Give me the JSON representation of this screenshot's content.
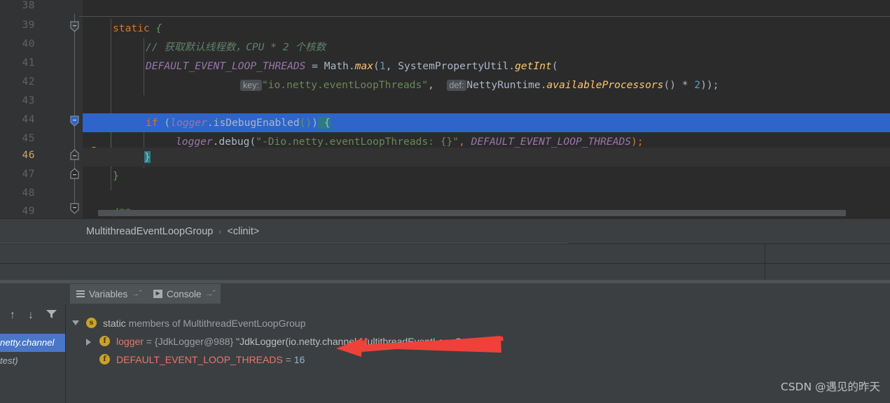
{
  "editor": {
    "lines": [
      {
        "no": "38",
        "state": "normal"
      },
      {
        "no": "39",
        "state": "normal"
      },
      {
        "no": "40",
        "state": "normal"
      },
      {
        "no": "41",
        "state": "normal"
      },
      {
        "no": "42",
        "state": "normal"
      },
      {
        "no": "43",
        "state": "normal"
      },
      {
        "no": "44",
        "state": "selected"
      },
      {
        "no": "45",
        "state": "normal"
      },
      {
        "no": "46",
        "state": "current"
      },
      {
        "no": "47",
        "state": "normal"
      },
      {
        "no": "48",
        "state": "normal"
      },
      {
        "no": "49",
        "state": "normal"
      }
    ],
    "code": {
      "l38": "",
      "l39_kw": "static",
      "l39_br": " {",
      "l40_comment": "// 获取默认线程数，CPU * 2 个核数",
      "l41_field": "DEFAULT_EVENT_LOOP_THREADS",
      "l41_rest1": " = Math.",
      "l41_method": "max",
      "l41_rest2": "(",
      "l41_num": "1",
      "l41_rest3": ", SystemPropertyUtil.",
      "l41_method2": "getInt",
      "l41_rest4": "(",
      "l42_hint_key": "key:",
      "l42_str": "\"io.netty.eventLoopThreads\"",
      "l42_comma": ",",
      "l42_hint_def": "def:",
      "l42_cls": "NettyRuntime.",
      "l42_method": "availableProcessors",
      "l42_rest": "() * ",
      "l42_num": "2",
      "l42_tail": "));",
      "l44_kw": "if",
      "l44_p1": " (",
      "l44_var": "logger",
      "l44_call": ".isDebugEnabled",
      "l44_p2": "()",
      "l44_p3": ")",
      "l44_brace": " {",
      "l45_var": "logger",
      "l45_call": ".debug",
      "l45_p1": "(",
      "l45_str": "\"-Dio.netty.eventLoopThreads: {}\"",
      "l45_comma": ", ",
      "l45_field": "DEFAULT_EVENT_LOOP_THREADS",
      "l45_tail": ");",
      "l46_brace": "}",
      "l47_brace": "}",
      "l49_jdoc": "/**"
    }
  },
  "breadcrumb": {
    "class": "MultithreadEventLoopGroup",
    "separator": "›",
    "member": "<clinit>"
  },
  "debug": {
    "tabs": [
      {
        "label": "Variables",
        "icon": "hamburger-icon",
        "pin": "→˝",
        "active": true
      },
      {
        "label": "Console",
        "icon": "console-play-icon",
        "pin": "→˝",
        "active": false
      }
    ],
    "frames_toolbar": [
      {
        "name": "step-up-button",
        "glyph": "↑"
      },
      {
        "name": "step-down-button",
        "glyph": "↓"
      },
      {
        "name": "filter-button",
        "glyph": "▼"
      }
    ],
    "frames": [
      {
        "text": "netty.channel",
        "selected": true
      },
      {
        "text": "test)",
        "selected": false
      }
    ],
    "variables": [
      {
        "indent": 0,
        "expander": "down",
        "icon": "static-members-icon",
        "icon_letter": "s",
        "parts": [
          {
            "text": "static ",
            "style": "lite"
          },
          {
            "text": "members of MultithreadEventLoopGroup",
            "style": "dim"
          }
        ]
      },
      {
        "indent": 1,
        "expander": "right",
        "icon": "field-icon",
        "icon_letter": "f",
        "parts": [
          {
            "text": "logger",
            "style": "name"
          },
          {
            "text": " = ",
            "style": "eq"
          },
          {
            "text": "{JdkLogger@988} ",
            "style": "dim"
          },
          {
            "text": "\"JdkLogger(io.netty.channel.MultithreadEventLoopGroup)\"",
            "style": "lite"
          }
        ]
      },
      {
        "indent": 1,
        "expander": "none",
        "icon": "field-icon",
        "icon_letter": "f",
        "parts": [
          {
            "text": "DEFAULT_EVENT_LOOP_THREADS",
            "style": "name"
          },
          {
            "text": " = ",
            "style": "eq"
          },
          {
            "text": "16",
            "style": "num"
          }
        ]
      }
    ]
  },
  "annotation": {
    "arrow_color": "#f0403a"
  },
  "watermark": {
    "text": "CSDN @遇见的昨天"
  },
  "colors": {
    "editor_bg": "#2b2b2b",
    "panel_bg": "#3c3f41",
    "gutter_bg": "#313335",
    "selection_blue": "#2f65ca",
    "current_line": "#323232",
    "keyword_orange": "#cc7832",
    "string_green": "#6a8759",
    "comment_green": "#5f826b",
    "field_purple": "#9876aa",
    "number_blue": "#6897bb",
    "method_yellow": "#ffc66d",
    "var_salmon": "#e8756e"
  }
}
